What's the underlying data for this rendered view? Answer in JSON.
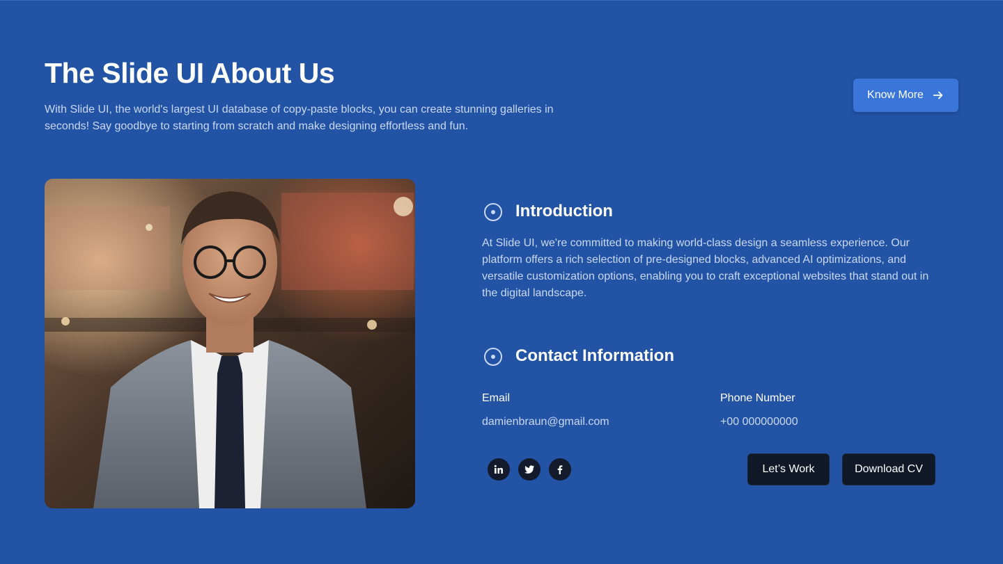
{
  "header": {
    "title": "The Slide UI About Us",
    "subtitle": "With Slide UI, the world's largest UI database of copy-paste blocks, you can create stunning galleries in seconds! Say goodbye to starting from scratch and make designing effortless and fun.",
    "cta_label": "Know More",
    "cta_icon": "arrow-right-icon"
  },
  "profile_photo": {
    "alt": "Smiling man in glasses wearing a grey suit and dark tie"
  },
  "introduction": {
    "icon": "circle-dot-icon",
    "title": "Introduction",
    "body": "At Slide UI, we're committed to making world-class design a seamless experience. Our platform offers a rich selection of pre-designed blocks, advanced AI optimizations, and versatile customization options, enabling you to craft exceptional websites that stand out in the digital landscape."
  },
  "contact": {
    "icon": "circle-dot-icon",
    "title": "Contact Information",
    "email_label": "Email",
    "email_value": "damienbraun@gmail.com",
    "phone_label": "Phone Number",
    "phone_value": "+00 000000000"
  },
  "social": [
    {
      "name": "linkedin-icon",
      "glyph": "in"
    },
    {
      "name": "twitter-icon"
    },
    {
      "name": "facebook-icon",
      "glyph": "f"
    }
  ],
  "actions": {
    "lets_work": "Let’s Work",
    "download_cv": "Download CV"
  },
  "colors": {
    "background": "#2353a5",
    "button_primary": "#3a76da",
    "button_dark": "#111827",
    "text_muted": "#c9d8f4"
  }
}
